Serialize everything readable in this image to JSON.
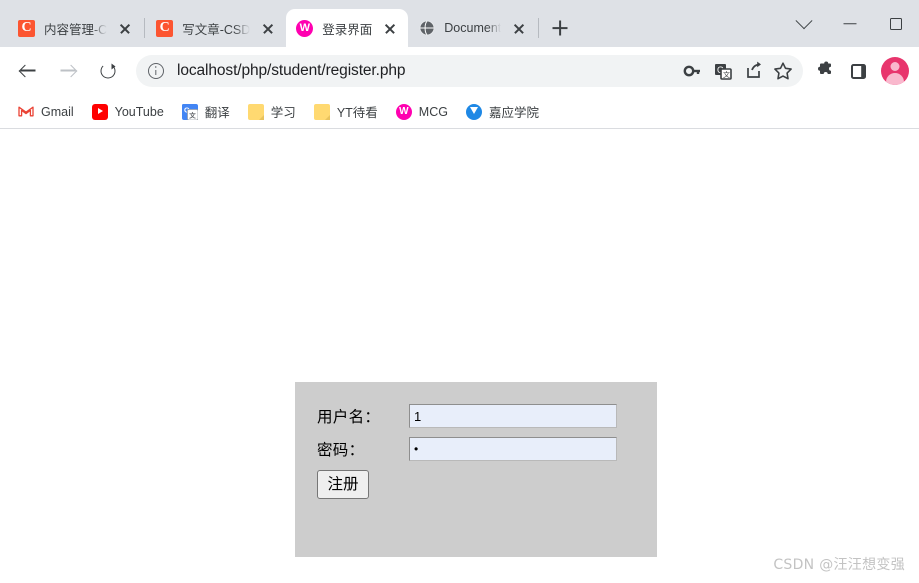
{
  "window": {
    "controls": [
      {
        "name": "chevron-down",
        "label": ""
      },
      {
        "name": "minimize",
        "label": ""
      },
      {
        "name": "maximize",
        "label": ""
      }
    ]
  },
  "tabs": [
    {
      "title": "内容管理-C",
      "favicon": "csdn-icon",
      "active": false
    },
    {
      "title": "写文章-CSD",
      "favicon": "csdn-icon",
      "active": false
    },
    {
      "title": "登录界面",
      "favicon": "mcg-w-icon",
      "active": true
    },
    {
      "title": "Document",
      "favicon": "globe-icon",
      "active": false
    }
  ],
  "newtab_label": "+",
  "toolbar": {
    "back_label": "Back",
    "forward_label": "Forward",
    "reload_label": "Reload",
    "url": "localhost/php/student/register.php",
    "url_placeholder": "Search Google or type a URL",
    "omnibox_icons": [
      "key-icon",
      "translate-icon",
      "share-icon",
      "star-icon"
    ],
    "extension_icons": [
      "puzzle-icon",
      "sidepanel-icon"
    ],
    "profile_label": "Profile"
  },
  "bookmarks": [
    {
      "label": "Gmail",
      "icon": "gmail-icon"
    },
    {
      "label": "YouTube",
      "icon": "youtube-icon"
    },
    {
      "label": "翻译",
      "icon": "google-translate-icon"
    },
    {
      "label": "学习",
      "icon": "folder-icon"
    },
    {
      "label": "YT待看",
      "icon": "folder-icon"
    },
    {
      "label": "MCG",
      "icon": "mcg-w-icon"
    },
    {
      "label": "嘉应学院",
      "icon": "jiaying-icon"
    }
  ],
  "page": {
    "form": {
      "username_label": "用户名：",
      "username_value": "1",
      "username_placeholder": "",
      "password_label": "密码：",
      "password_value": "•",
      "password_placeholder": "",
      "submit_label": "注册"
    },
    "watermark": "CSDN @汪汪想变强",
    "panel_color": "#cdcdcd",
    "input_color": "#e8eefa"
  }
}
